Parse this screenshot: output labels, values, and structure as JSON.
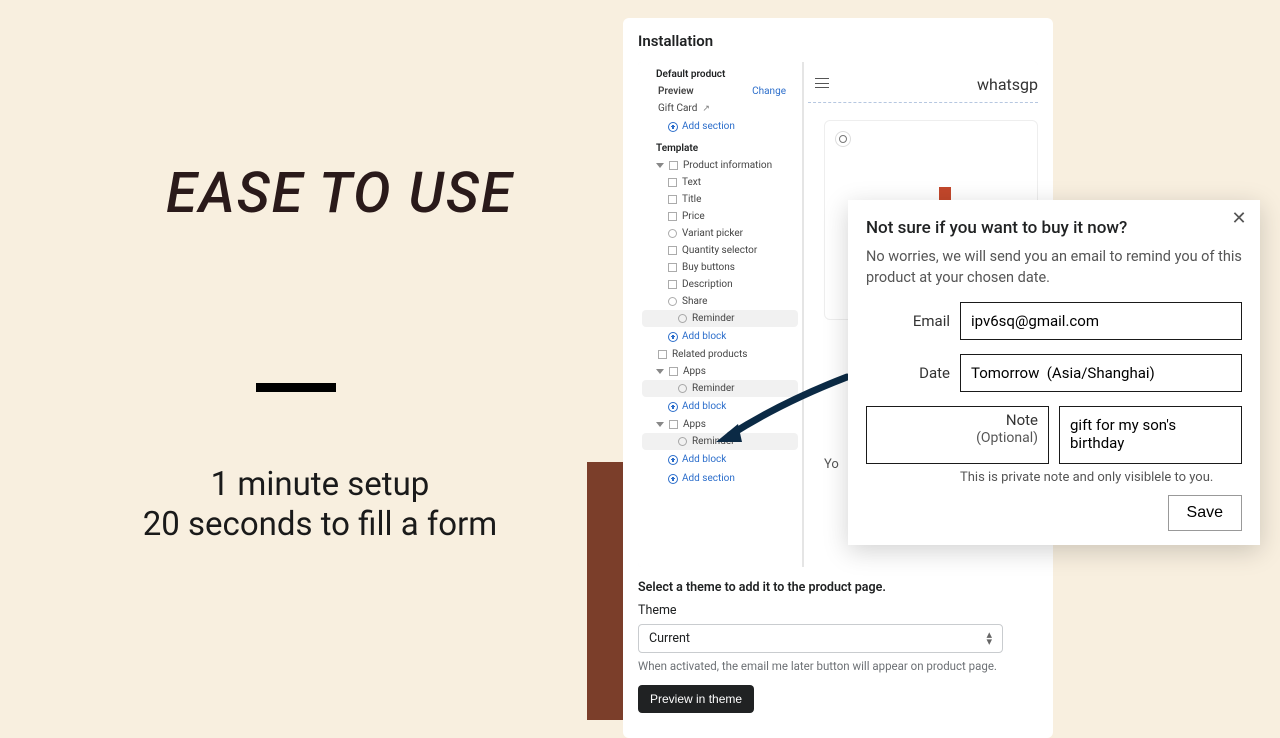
{
  "marketing": {
    "title": "EASE TO USE",
    "line1": "1 minute setup",
    "line2": "20 seconds to fill a form"
  },
  "installation": {
    "title": "Installation",
    "default_product": "Default product",
    "preview_label": "Preview",
    "change": "Change",
    "gift_card": "Gift Card",
    "add_section": "Add section",
    "template_label": "Template",
    "product_info": "Product information",
    "items": {
      "text": "Text",
      "title": "Title",
      "price": "Price",
      "variant_picker": "Variant picker",
      "quantity_selector": "Quantity selector",
      "buy_buttons": "Buy buttons",
      "description": "Description",
      "share": "Share",
      "reminder": "Reminder"
    },
    "add_block": "Add block",
    "related_products": "Related products",
    "apps": "Apps",
    "brand": "whatsgp",
    "yo": "Yo",
    "select_theme_title": "Select a theme to add it to the product page.",
    "theme_label": "Theme",
    "theme_value": "Current",
    "theme_helper": "When activated, the email me later button will appear on product page.",
    "preview_btn": "Preview in theme"
  },
  "modal": {
    "title": "Not sure if you want to buy it now?",
    "desc": "No worries, we will send you an email to remind you of this product at your chosen date.",
    "email_label": "Email",
    "email_value": "ipv6sq@gmail.com",
    "date_label": "Date",
    "date_value": "Tomorrow  (Asia/Shanghai)",
    "note_label": "Note",
    "note_sublabel": "(Optional)",
    "note_value": "gift for my son's birthday",
    "note_help": "This is private note and only visiblele to you.",
    "save": "Save"
  }
}
